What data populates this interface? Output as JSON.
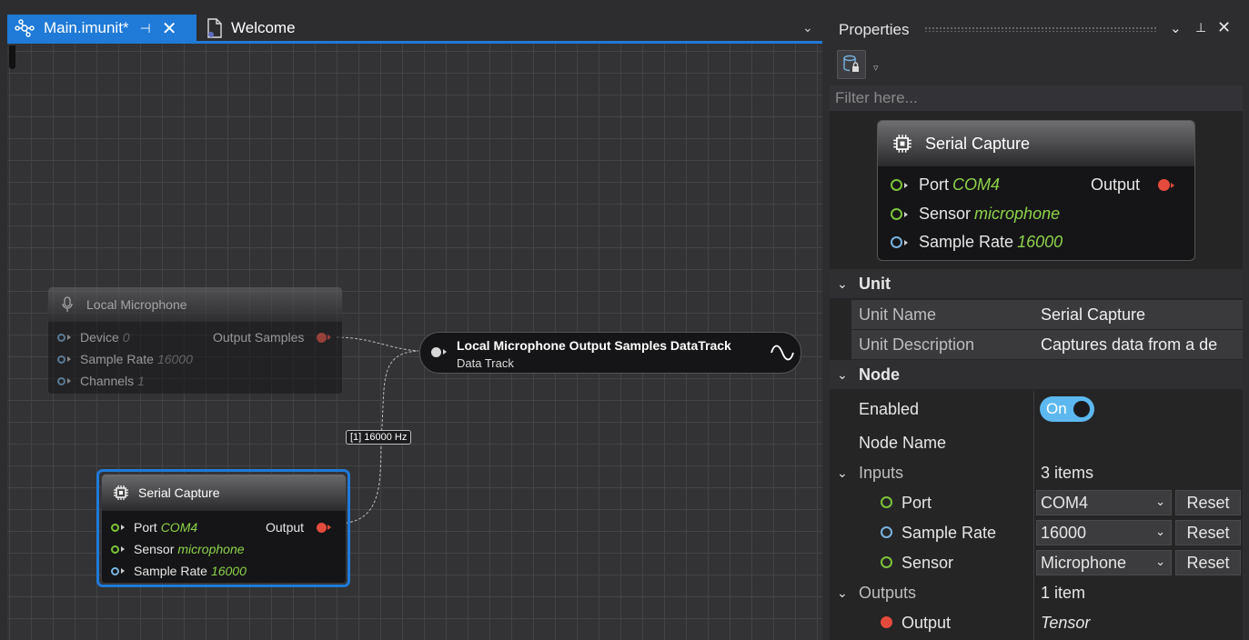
{
  "tabs": {
    "main_label": "Main.imunit*",
    "welcome_label": "Welcome"
  },
  "canvas": {
    "mic_node": {
      "title": "Local Microphone",
      "device_label": "Device",
      "device_value": "0",
      "sample_rate_label": "Sample Rate",
      "sample_rate_value": "16000",
      "channels_label": "Channels",
      "channels_value": "1",
      "output_label": "Output Samples"
    },
    "datatrack_node": {
      "title": "Local Microphone Output Samples DataTrack",
      "subtitle": "Data Track"
    },
    "link_label": "[1] 16000 Hz",
    "serial_node": {
      "title": "Serial Capture",
      "port_label": "Port",
      "port_value": "COM4",
      "sensor_label": "Sensor",
      "sensor_value": "microphone",
      "sample_rate_label": "Sample Rate",
      "sample_rate_value": "16000",
      "output_label": "Output"
    }
  },
  "properties": {
    "title": "Properties",
    "filter_placeholder": "Filter here...",
    "preview": {
      "title": "Serial Capture",
      "port_label": "Port",
      "port_value": "COM4",
      "sensor_label": "Sensor",
      "sensor_value": "microphone",
      "sample_rate_label": "Sample Rate",
      "sample_rate_value": "16000",
      "output_label": "Output"
    },
    "unit_section": "Unit",
    "unit_name_label": "Unit Name",
    "unit_name_value": "Serial Capture",
    "unit_desc_label": "Unit Description",
    "unit_desc_value": "Captures data from a de",
    "node_section": "Node",
    "enabled_label": "Enabled",
    "enabled_value": "On",
    "node_name_label": "Node Name",
    "inputs_label": "Inputs",
    "inputs_count": "3 items",
    "inputs": [
      {
        "name": "Port",
        "value": "COM4",
        "reset": "Reset"
      },
      {
        "name": "Sample Rate",
        "value": "16000",
        "reset": "Reset"
      },
      {
        "name": "Sensor",
        "value": "Microphone",
        "reset": "Reset"
      }
    ],
    "outputs_label": "Outputs",
    "outputs_count": "1 item",
    "output_name": "Output",
    "output_value": "Tensor"
  },
  "colors": {
    "accent": "#1f7ad8",
    "pin_green": "#7cc43a",
    "pin_blue": "#7ab3e0",
    "output_red": "#e54b3c",
    "value_green": "#8ed24a",
    "toggle_on": "#5db8f0"
  }
}
